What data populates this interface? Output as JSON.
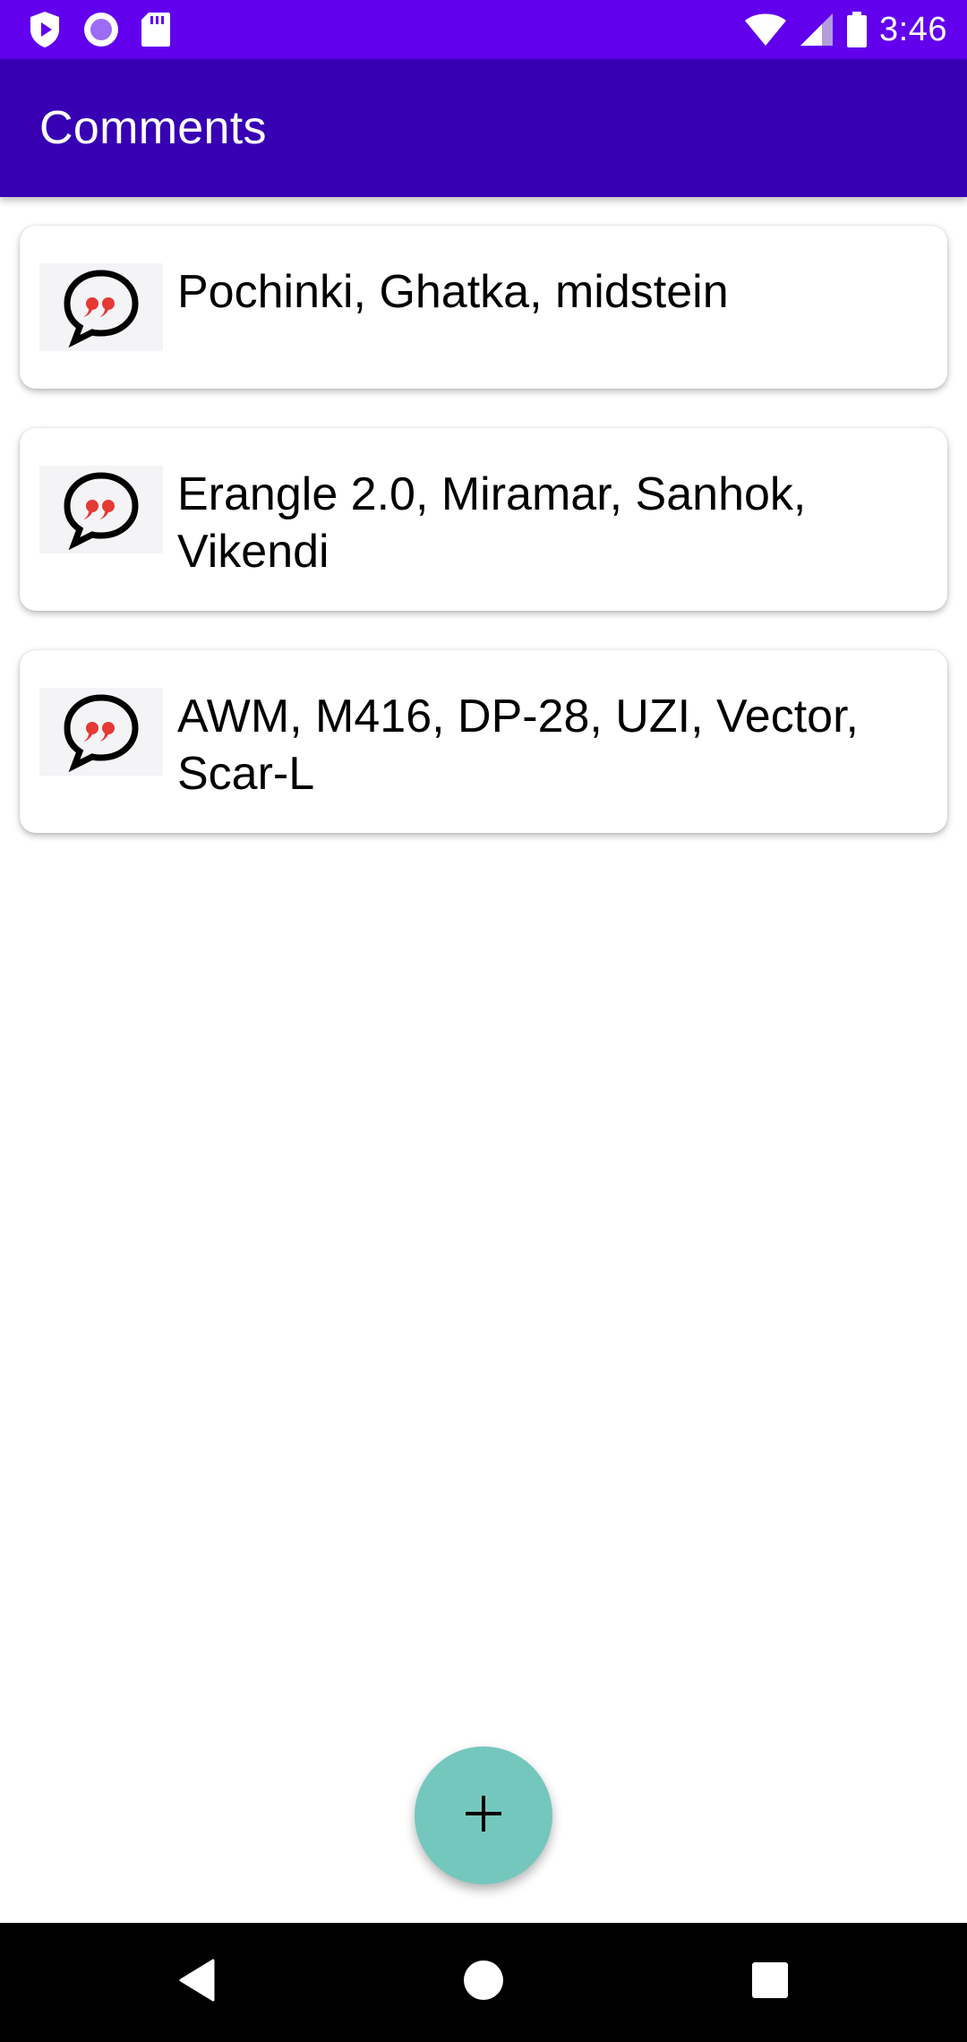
{
  "status_bar": {
    "time": "3:46",
    "icons_left": [
      "shield-play-icon",
      "circle-record-icon",
      "sd-card-icon"
    ],
    "icons_right": [
      "wifi-icon",
      "signal-icon",
      "battery-icon"
    ]
  },
  "app_bar": {
    "title": "Comments"
  },
  "comments": [
    {
      "text": "Pochinki, Ghatka, midstein",
      "icon": "quote-bubble-icon"
    },
    {
      "text": "Erangle 2.0, Miramar, Sanhok, Vikendi",
      "icon": "quote-bubble-icon"
    },
    {
      "text": "AWM, M416, DP-28, UZI, Vector, Scar-L",
      "icon": "quote-bubble-icon"
    }
  ],
  "fab": {
    "icon": "plus-icon"
  },
  "nav_bar": {
    "buttons": [
      "back-icon",
      "home-icon",
      "recents-icon"
    ]
  },
  "colors": {
    "status_bar": "#6200ee",
    "app_bar": "#3700b3",
    "fab": "#74c7bd",
    "quote_marks": "#e53935"
  }
}
